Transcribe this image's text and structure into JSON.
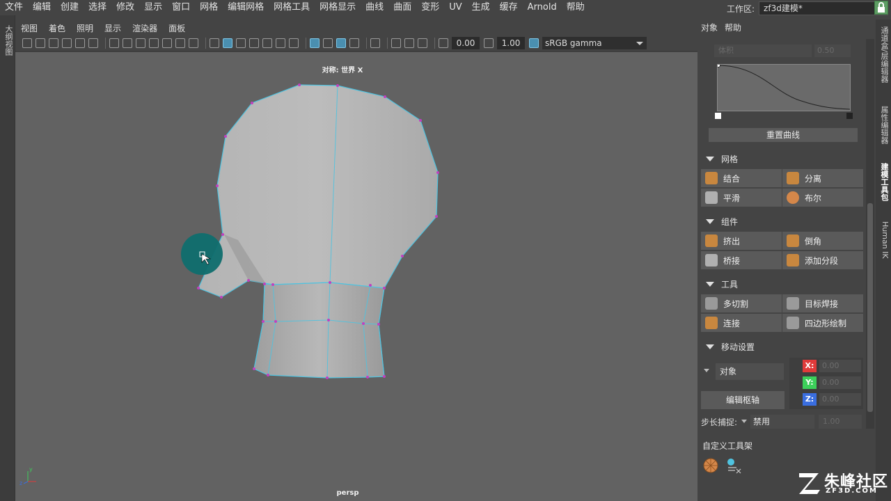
{
  "menubar": {
    "items": [
      "文件",
      "编辑",
      "创建",
      "选择",
      "修改",
      "显示",
      "窗口",
      "网格",
      "编辑网格",
      "网格工具",
      "网格显示",
      "曲线",
      "曲面",
      "变形",
      "UV",
      "生成",
      "缓存",
      "Arnold",
      "帮助"
    ],
    "workspace_label": "工作区:",
    "workspace_value": "zf3d建模*"
  },
  "left_strip": {
    "tab": "大纲视图"
  },
  "viewport": {
    "menu": [
      "视图",
      "着色",
      "照明",
      "显示",
      "渲染器",
      "面板"
    ],
    "exposure": "0.00",
    "gamma": "1.00",
    "color_space": "sRGB gamma",
    "symmetry_label": "对称: 世界 X",
    "camera_label": "persp"
  },
  "right_panel": {
    "menu": [
      "对象",
      "帮助"
    ],
    "faded_dropdown": "体积",
    "faded_value": "0.50",
    "reset_curve": "重置曲线",
    "sections": {
      "mesh": {
        "title": "网格",
        "buttons": [
          "结合",
          "分离",
          "平滑",
          "布尔"
        ]
      },
      "components": {
        "title": "组件",
        "buttons": [
          "挤出",
          "倒角",
          "桥接",
          "添加分段"
        ]
      },
      "tools": {
        "title": "工具",
        "buttons": [
          "多切割",
          "目标焊接",
          "连接",
          "四边形绘制"
        ]
      },
      "move": {
        "title": "移动设置",
        "object_sel": "对象",
        "edit_pivot": "编辑枢轴",
        "x_label": "X:",
        "y_label": "Y:",
        "z_label": "Z:",
        "x_val": "0.00",
        "y_val": "0.00",
        "z_val": "0.00",
        "snap_label": "步长捕捉:",
        "snap_value": "禁用",
        "snap_step": "1.00"
      }
    },
    "shelf_title": "自定义工具架",
    "tabs": [
      "通道盒/层编辑器",
      "属性编辑器",
      "建模工具包",
      "Human IK"
    ]
  },
  "watermark": {
    "text": "朱峰社区",
    "sub": "ZF3D.COM"
  },
  "colors": {
    "accent": "#4fc3e0",
    "vertex": "#c040c0",
    "brush": "#0f6e6e",
    "axis_x": "#e03a3a",
    "axis_y": "#3ccf5a",
    "axis_z": "#3a6ee0"
  }
}
